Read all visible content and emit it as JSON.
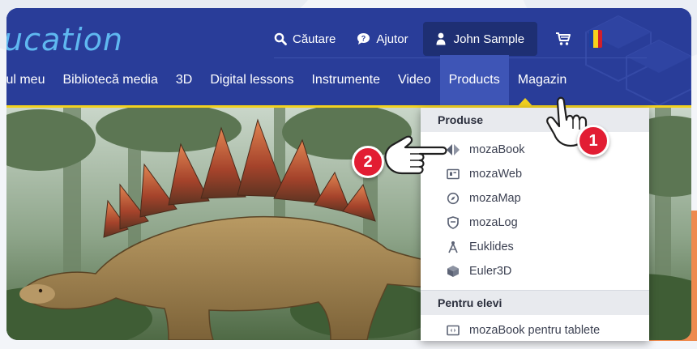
{
  "brand": {
    "logo_text": "ucation"
  },
  "top_bar": {
    "search_label": "Căutare",
    "help_label": "Ajutor",
    "user_name": "John Sample"
  },
  "nav": {
    "items": [
      {
        "label": "tul meu"
      },
      {
        "label": "Bibliotecă media"
      },
      {
        "label": "3D"
      },
      {
        "label": "Digital lessons"
      },
      {
        "label": "Instrumente"
      },
      {
        "label": "Video"
      },
      {
        "label": "Products"
      },
      {
        "label": "Magazin"
      }
    ],
    "active": "Products"
  },
  "dropdown": {
    "section1_title": "Produse",
    "section1_items": [
      {
        "label": "mozaBook",
        "icon": "mozabook-icon"
      },
      {
        "label": "mozaWeb",
        "icon": "mozaweb-icon"
      },
      {
        "label": "mozaMap",
        "icon": "mozamap-icon"
      },
      {
        "label": "mozaLog",
        "icon": "mozalog-icon"
      },
      {
        "label": "Euklides",
        "icon": "euklides-icon"
      },
      {
        "label": "Euler3D",
        "icon": "euler3d-icon"
      }
    ],
    "section2_title": "Pentru elevi",
    "section2_items": [
      {
        "label": "mozaBook pentru tablete",
        "icon": "tablet-icon"
      }
    ]
  },
  "callouts": {
    "step1": "1",
    "step2": "2"
  },
  "colors": {
    "header_bg": "#293d99",
    "active_tab_bg": "#3e55b6",
    "accent_yellow": "#f2d11f",
    "badge_red": "#e21d33",
    "logo_blue": "#5fb8f0"
  },
  "flag_colors": [
    "#1d3f9e",
    "#f7d21c",
    "#d21f2b"
  ]
}
